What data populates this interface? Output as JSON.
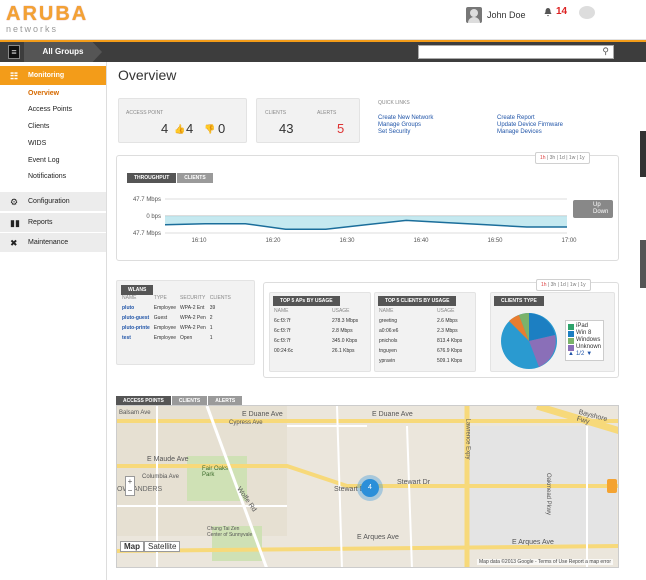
{
  "brand": {
    "name": "ARUBA",
    "sub": "networks"
  },
  "user": {
    "name": "John Doe",
    "alerts": "14"
  },
  "navbar": {
    "group": "All Groups",
    "search_placeholder": ""
  },
  "sidebar": {
    "monitoring": "Monitoring",
    "items": [
      "Overview",
      "Access Points",
      "Clients",
      "WIDS",
      "Event Log",
      "Notifications"
    ],
    "configuration": "Configuration",
    "reports": "Reports",
    "maintenance": "Maintenance"
  },
  "page": {
    "title": "Overview"
  },
  "summary": {
    "access_point_label": "ACCESS POINT",
    "ap_total": "4",
    "ap_up": "4",
    "ap_down": "0",
    "clients_label": "CLIENTS",
    "clients_value": "43",
    "alerts_label": "ALERTS",
    "alerts_value": "5"
  },
  "quick_links": {
    "title": "QUICK LINKS",
    "left": [
      "Create New Network",
      "Manage Groups",
      "Set Security"
    ],
    "right": [
      "Create Report",
      "Update Device Firmware",
      "Manage Devices"
    ]
  },
  "time_filter": {
    "items": [
      "1h",
      "3h",
      "1d",
      "1w",
      "1y"
    ],
    "active": "1h"
  },
  "throughput": {
    "tabs": [
      "THROUGHPUT",
      "CLIENTS"
    ],
    "y_labels": [
      "47.7 Mbps",
      "0 bps",
      "47.7 Mbps"
    ],
    "x_labels": [
      "16:10",
      "16:20",
      "16:30",
      "16:40",
      "16:50",
      "17:00"
    ],
    "legend": [
      "Up",
      "Down"
    ]
  },
  "chart_data": {
    "type": "area",
    "x": [
      "16:05",
      "16:10",
      "16:15",
      "16:20",
      "16:25",
      "16:30",
      "16:35",
      "16:40",
      "16:45",
      "16:50",
      "16:55"
    ],
    "series": [
      {
        "name": "Up",
        "values": [
          0,
          0,
          0,
          0,
          0,
          0,
          0,
          0,
          0,
          0,
          0
        ]
      },
      {
        "name": "Down",
        "values": [
          -8,
          -7,
          -7,
          -12,
          -12,
          -8,
          -4,
          -6,
          -8,
          -10,
          -10
        ]
      }
    ],
    "y_ticks": [
      "47.7 Mbps",
      "0 bps",
      "47.7 Mbps"
    ],
    "x_ticks": [
      "16:10",
      "16:20",
      "16:30",
      "16:40",
      "16:50",
      "17:00"
    ],
    "colors": {
      "Up": "#b7e3ec",
      "Down": "#1b6e9b"
    }
  },
  "wlans": {
    "title": "WLANS",
    "columns": [
      "NAME",
      "TYPE",
      "SECURITY",
      "CLIENTS"
    ],
    "rows": [
      [
        "pluto",
        "Employee",
        "WPA-2 Ent",
        "39"
      ],
      [
        "pluto-guest",
        "Guest",
        "WPA-2 Pen",
        "2"
      ],
      [
        "pluto-printe",
        "Employee",
        "WPA-2 Pen",
        "1"
      ],
      [
        "test",
        "Employee",
        "Open",
        "1"
      ]
    ]
  },
  "top_aps": {
    "title": "TOP 5 APs BY USAGE",
    "columns": [
      "NAME",
      "USAGE"
    ],
    "rows": [
      [
        "6c:f3:7f",
        "278.3 Mbps"
      ],
      [
        "6c:f3:7f",
        "2.8 Mbps"
      ],
      [
        "6c:f3:7f",
        "345.0 Kbps"
      ],
      [
        "00:24:6c",
        "26.1 Kbps"
      ]
    ]
  },
  "top_clients": {
    "title": "TOP 5 CLIENTS BY USAGE",
    "columns": [
      "NAME",
      "USAGE"
    ],
    "rows": [
      [
        "greeting",
        "2.6 Mbps"
      ],
      [
        "a0:06:e6",
        "2.3 Mbps"
      ],
      [
        "pnichols",
        "813.4 Kbps"
      ],
      [
        "tnguyen",
        "676.9 Kbps"
      ],
      [
        "ypravin",
        "509.1 Kbps"
      ]
    ]
  },
  "clients_type": {
    "title": "CLIENTS TYPE",
    "legend": [
      "iPad",
      "Win 8",
      "Windows",
      "Unknown"
    ],
    "colors": [
      "#2ea36b",
      "#1c7fc2",
      "#7bb36b",
      "#8a6fb8"
    ],
    "pager": "1/2"
  },
  "map_panel": {
    "tabs": [
      "ACCESS POINTS",
      "CLIENTS",
      "ALERTS"
    ],
    "map_btn": "Map",
    "satellite_btn": "Satellite",
    "cluster": "4",
    "footer": "Map data ©2013 Google - Terms of Use",
    "report": "Report a map error",
    "streets": [
      "E Duane Ave",
      "Stewart Dr",
      "Stewart Dr",
      "E Arques Ave",
      "E Arques Ave",
      "E Maude Ave",
      "Columbia Ave",
      "Fair Oaks Park",
      "OWLANDERS",
      "Wolfe Rd",
      "Lawrence Expy",
      "Oakmead Pkwy",
      "Bayshore Fwy",
      "Chung Tai Zen Center of Sunnyvale",
      "Balsam Ave",
      "Cypress Ave"
    ]
  }
}
